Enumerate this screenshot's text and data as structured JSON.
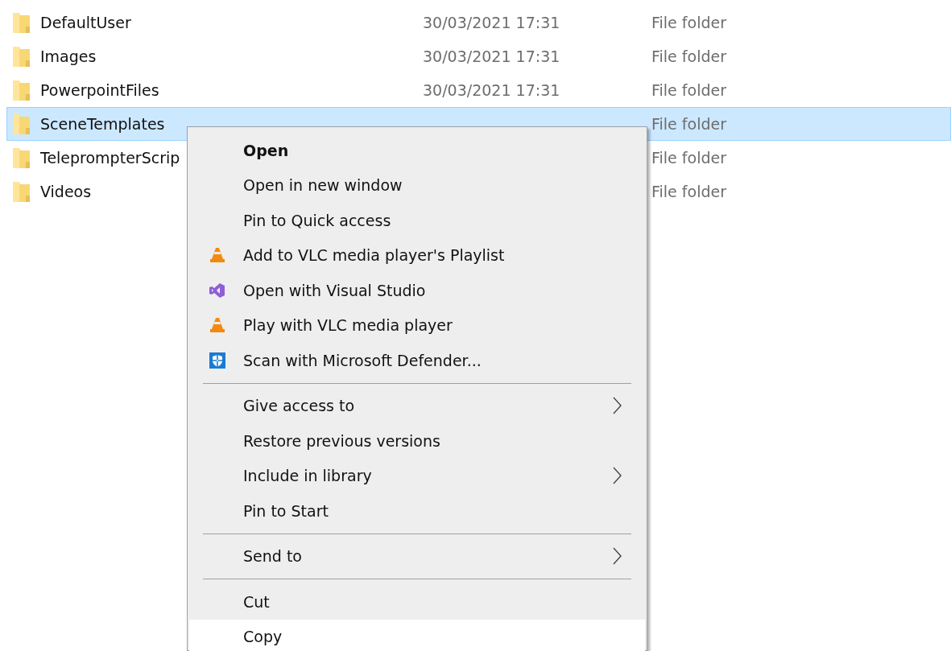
{
  "files": [
    {
      "name": "DefaultUser",
      "date": "30/03/2021 17:31",
      "type": "File folder",
      "selected": false
    },
    {
      "name": "Images",
      "date": "30/03/2021 17:31",
      "type": "File folder",
      "selected": false
    },
    {
      "name": "PowerpointFiles",
      "date": "30/03/2021 17:31",
      "type": "File folder",
      "selected": false
    },
    {
      "name": "SceneTemplates",
      "type": "File folder",
      "selected": true
    },
    {
      "name": "TeleprompterScrip",
      "type": "File folder",
      "selected": false
    },
    {
      "name": "Videos",
      "type": "File folder",
      "selected": false
    }
  ],
  "context_menu": {
    "items": [
      {
        "kind": "text",
        "label": "Open",
        "default": true,
        "submenu": false,
        "highlighted": false
      },
      {
        "kind": "text",
        "label": "Open in new window",
        "default": false,
        "submenu": false,
        "highlighted": false
      },
      {
        "kind": "text",
        "label": "Pin to Quick access",
        "default": false,
        "submenu": false,
        "highlighted": false
      },
      {
        "kind": "cone",
        "label": "Add to VLC media player's Playlist",
        "default": false,
        "submenu": false,
        "highlighted": false
      },
      {
        "kind": "infinity",
        "label": "Open with Visual Studio",
        "default": false,
        "submenu": false,
        "highlighted": false
      },
      {
        "kind": "cone",
        "label": "Play with VLC media player",
        "default": false,
        "submenu": false,
        "highlighted": false
      },
      {
        "kind": "shield",
        "label": "Scan with Microsoft Defender...",
        "default": false,
        "submenu": false,
        "highlighted": false
      },
      {
        "kind": "separator"
      },
      {
        "kind": "text",
        "label": "Give access to",
        "default": false,
        "submenu": true,
        "highlighted": false
      },
      {
        "kind": "text",
        "label": "Restore previous versions",
        "default": false,
        "submenu": false,
        "highlighted": false
      },
      {
        "kind": "text",
        "label": "Include in library",
        "default": false,
        "submenu": true,
        "highlighted": false
      },
      {
        "kind": "text",
        "label": "Pin to Start",
        "default": false,
        "submenu": false,
        "highlighted": false
      },
      {
        "kind": "separator"
      },
      {
        "kind": "text",
        "label": "Send to",
        "default": false,
        "submenu": true,
        "highlighted": false
      },
      {
        "kind": "separator"
      },
      {
        "kind": "text",
        "label": "Cut",
        "default": false,
        "submenu": false,
        "highlighted": false
      },
      {
        "kind": "text",
        "label": "Copy",
        "default": false,
        "submenu": false,
        "highlighted": true
      }
    ]
  }
}
